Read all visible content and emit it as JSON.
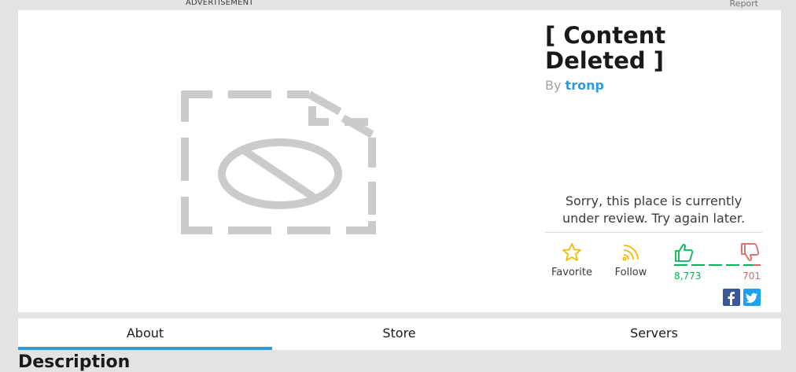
{
  "topbar": {
    "ad_label": "ADVERTISEMENT",
    "report_label": "Report"
  },
  "game": {
    "title": "[ Content Deleted ]",
    "by_label": "By",
    "creator": "tronp",
    "review_message": "Sorry, this place is currently under review. Try again later."
  },
  "actions": {
    "favorite_label": "Favorite",
    "follow_label": "Follow",
    "upvotes": "8,773",
    "downvotes": "701"
  },
  "tabs": [
    {
      "label": "About",
      "active": true
    },
    {
      "label": "Store",
      "active": false
    },
    {
      "label": "Servers",
      "active": false
    }
  ],
  "section": {
    "heading": "Description"
  },
  "colors": {
    "accent": "#2f9bd8",
    "upvote": "#02b757",
    "downvote": "#d86868",
    "favorite": "#f6b702"
  }
}
